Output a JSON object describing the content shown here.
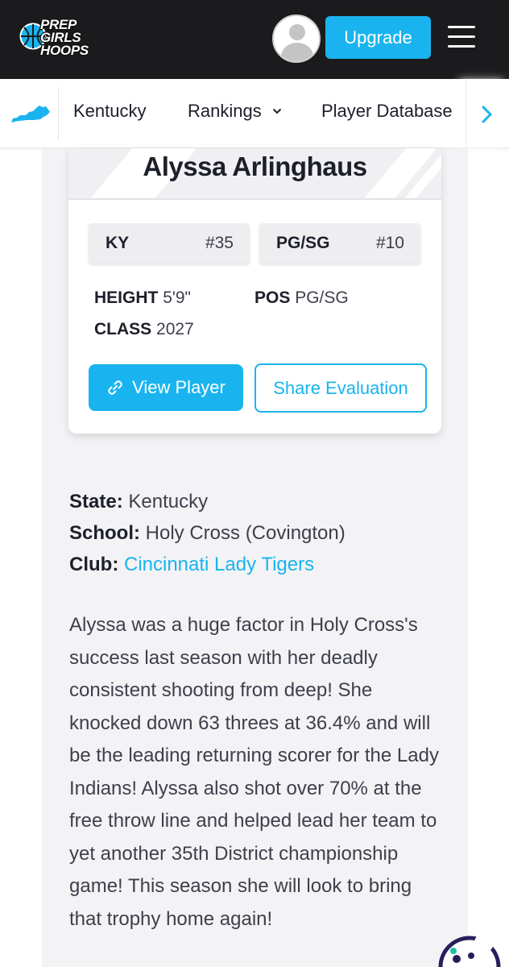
{
  "header": {
    "logo": {
      "line1": "PREP",
      "line2": "GIRLS",
      "line3": "HOOPS"
    },
    "upgrade_label": "Upgrade"
  },
  "subnav": {
    "state": "Kentucky",
    "rankings": "Rankings",
    "database": "Player Database"
  },
  "player": {
    "name": "Alyssa Arlinghaus",
    "state_rank": {
      "label": "KY",
      "value": "#35"
    },
    "position_rank": {
      "label": "PG/SG",
      "value": "#10"
    },
    "height_label": "HEIGHT",
    "height": "5'9\"",
    "pos_label": "POS",
    "pos": "PG/SG",
    "class_label": "CLASS",
    "class": "2027",
    "view_label": "View Player",
    "share_label": "Share Evaluation"
  },
  "info": {
    "state_label": "State:",
    "state": "Kentucky",
    "school_label": "School:",
    "school": "Holy Cross (Covington)",
    "club_label": "Club:",
    "club": "Cincinnati Lady Tigers"
  },
  "bio": "Alyssa was a huge factor in Holy Cross's success last season with her deadly consistent shooting from deep! She knocked down 63 threes at 36.4% and will be the leading returning scorer for the Lady Indians! Alyssa also shot over 70% at the free throw line and helped lead her team to yet another 35th District championship game! This season she will look to bring that trophy home again!",
  "colors": {
    "accent": "#19b4ef",
    "header_bg": "#1b1b1d",
    "text": "#1d1f2a"
  }
}
